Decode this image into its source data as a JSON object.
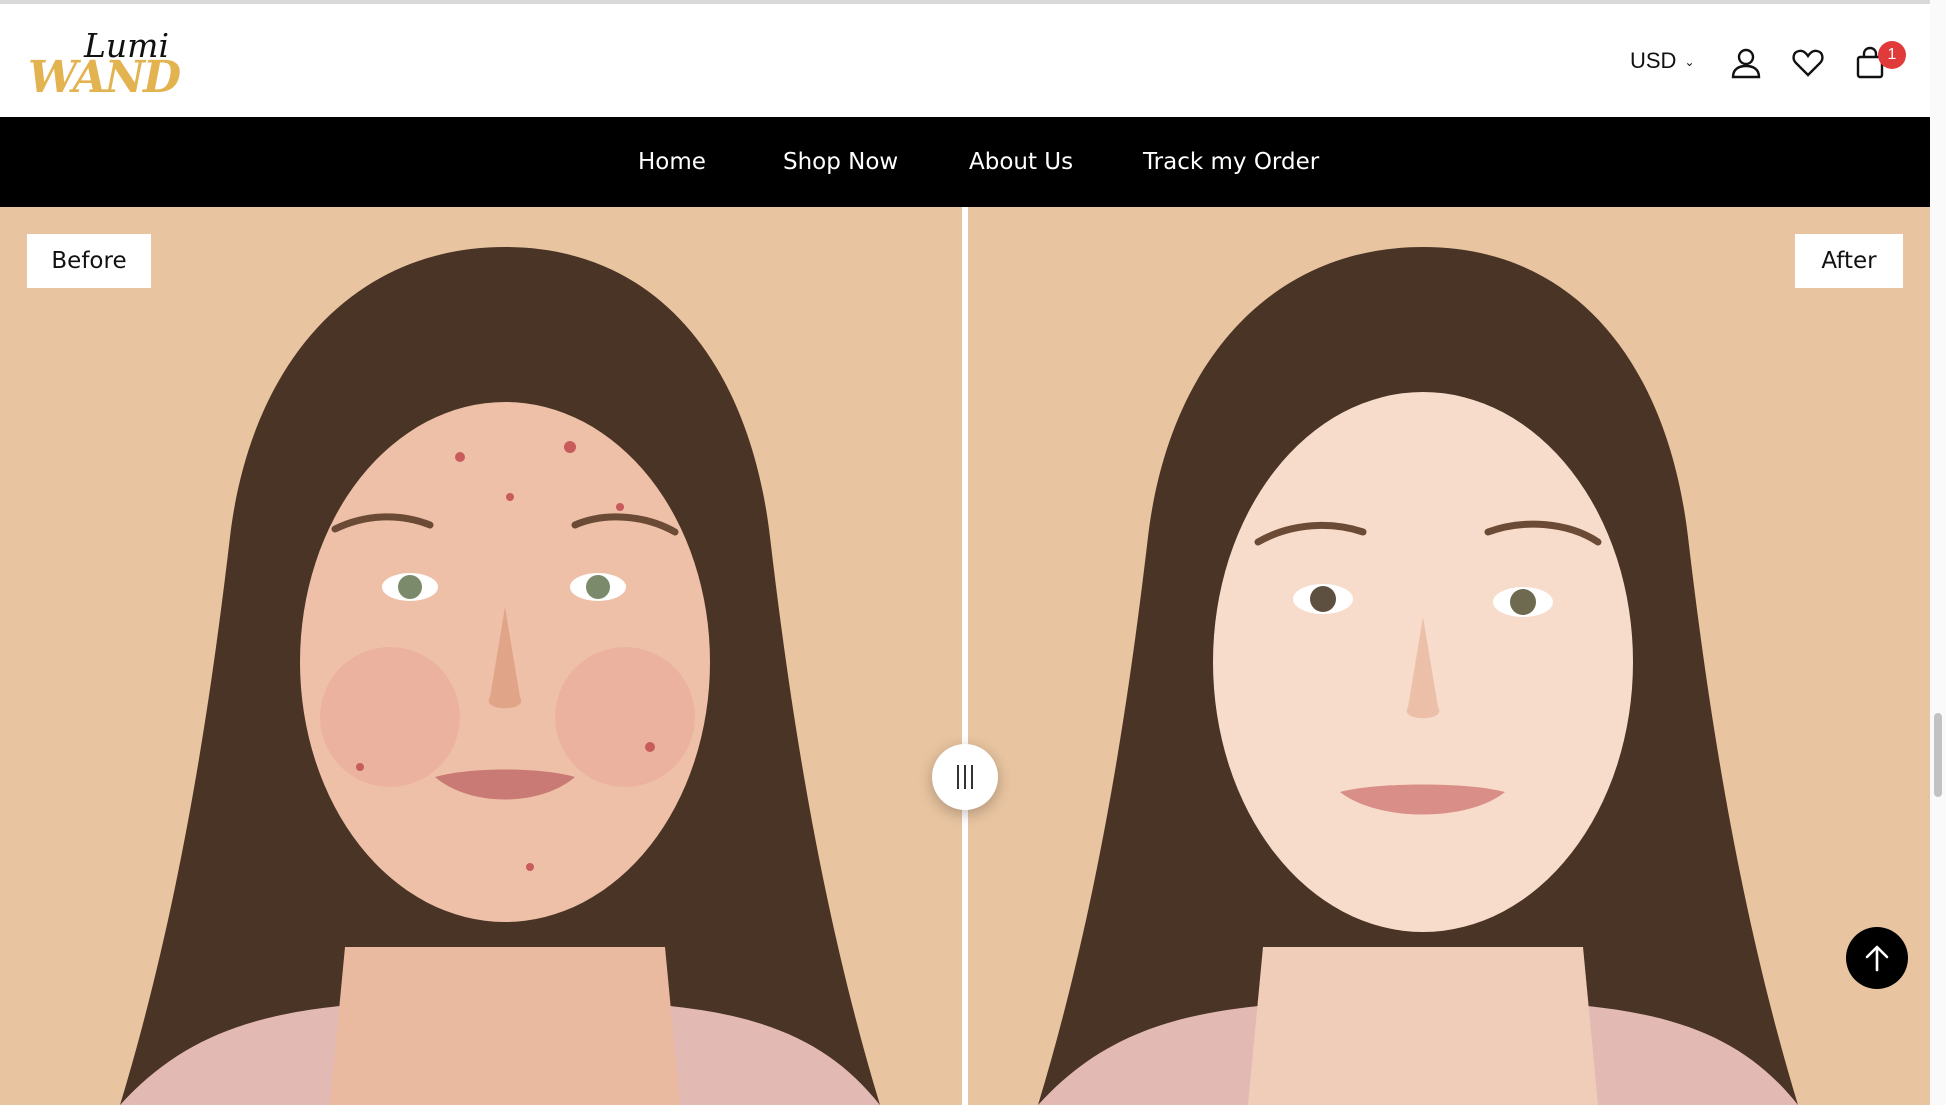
{
  "brand": {
    "logo_top": "Lumi",
    "logo_bottom": "WAND",
    "accent": "#e3b350"
  },
  "header": {
    "currency": "USD",
    "cart_count": "1",
    "icons": [
      "account-icon",
      "wishlist-heart-icon",
      "cart-bag-icon"
    ]
  },
  "nav": {
    "items": [
      {
        "label": "Home"
      },
      {
        "label": "Shop Now"
      },
      {
        "label": "About Us"
      },
      {
        "label": "Track my Order"
      }
    ]
  },
  "comparison": {
    "before_label": "Before",
    "after_label": "After",
    "background": "#e8c4a0",
    "slider_position": 0.5
  },
  "colors": {
    "nav_bg": "#000000",
    "cart_badge": "#e03a3a"
  }
}
